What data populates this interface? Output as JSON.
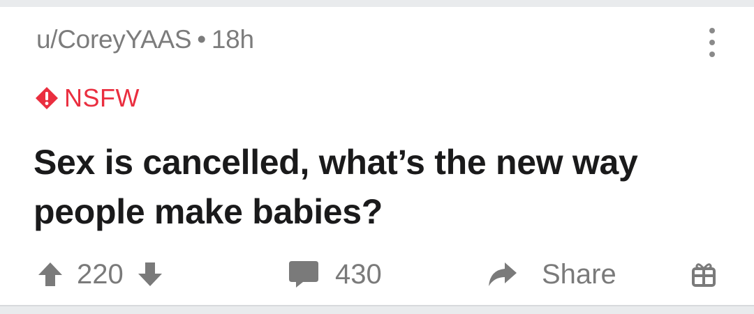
{
  "post": {
    "author": "u/CoreyYAAS",
    "separator": "•",
    "age": "18h",
    "nsfw_label": "NSFW",
    "title": "Sex is cancelled, what’s the new way people make babies?"
  },
  "actions": {
    "score": "220",
    "comments": "430",
    "share_label": "Share"
  },
  "colors": {
    "nsfw": "#ea2e3f",
    "icon_gray": "#7a7a7a",
    "title": "#1a1a1b",
    "meta": "#7c7c7c"
  },
  "icons": [
    "upvote-icon",
    "downvote-icon",
    "comment-icon",
    "share-icon",
    "award-gift-icon",
    "more-options-icon",
    "nsfw-warning-icon"
  ]
}
